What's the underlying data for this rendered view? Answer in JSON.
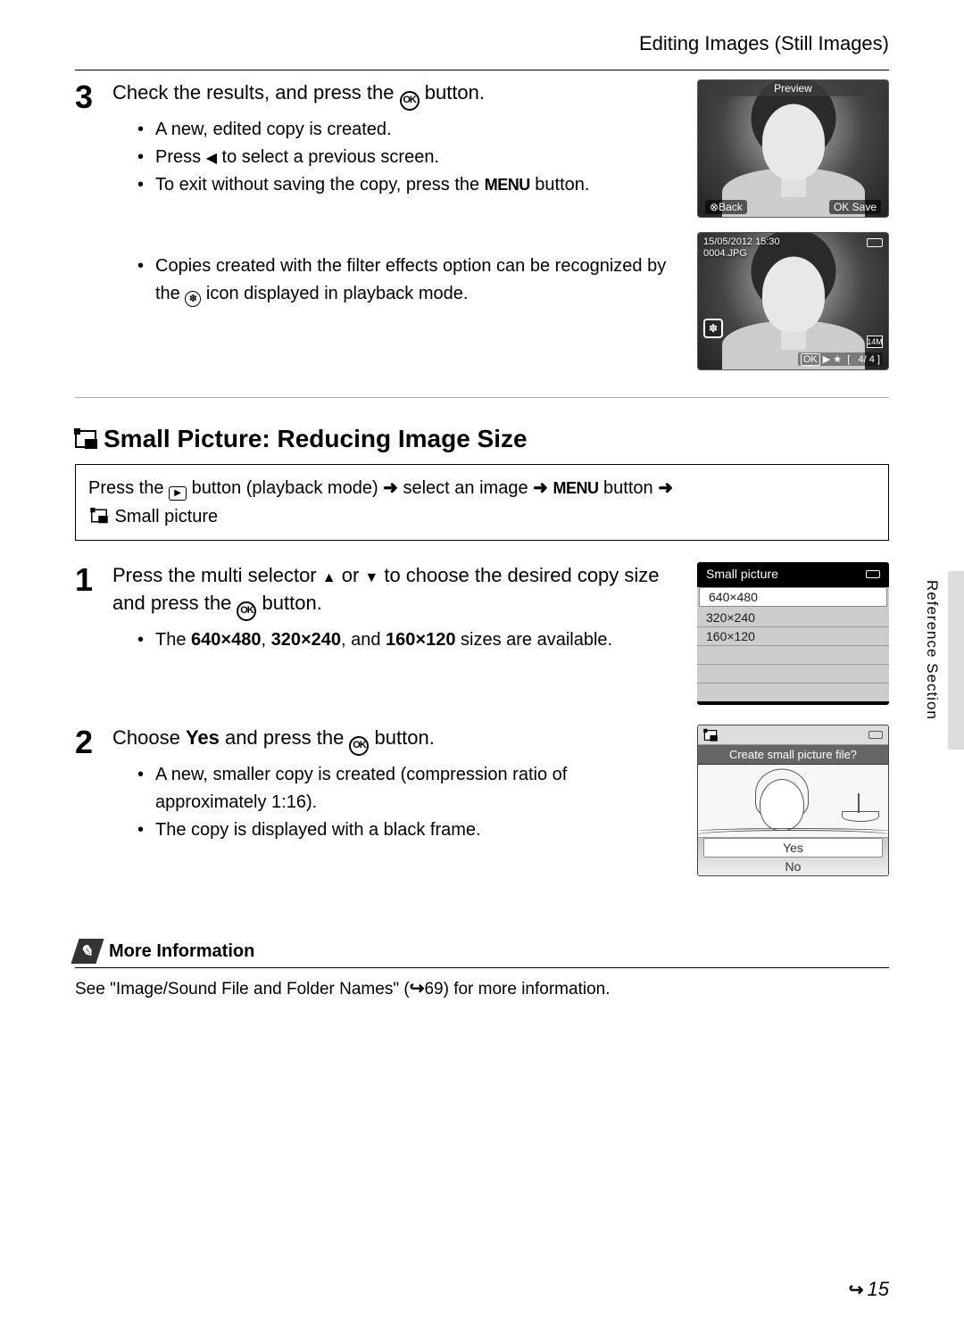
{
  "header": {
    "title": "Editing Images (Still Images)"
  },
  "step3": {
    "num": "3",
    "title_a": "Check the results, and press the ",
    "title_b": " button.",
    "bullets": [
      {
        "t1": "A new, edited copy is created."
      },
      {
        "t1": "Press ",
        "t2": " to select a previous screen."
      },
      {
        "t1": "To exit without saving the copy, press the ",
        "t2": " button."
      }
    ],
    "bullet2": {
      "t1": "Copies created with the filter effects option can be recognized by the ",
      "t2": " icon displayed in playback mode."
    }
  },
  "shot1": {
    "title": "Preview",
    "back": "Back",
    "save": "Save"
  },
  "shot2": {
    "date": "15/05/2012 15:30",
    "file": "0004.JPG",
    "index": "4/   4",
    "size": "14M"
  },
  "section": {
    "title": "Small Picture: Reducing Image Size",
    "path_a": "Press the ",
    "path_b": " button (playback mode) ",
    "path_c": " select an image ",
    "path_d": " button ",
    "path_e": " Small picture"
  },
  "step1": {
    "num": "1",
    "title_a": "Press the multi selector ",
    "title_b": " or ",
    "title_c": " to choose the desired copy size and press the ",
    "title_d": " button.",
    "bullet_a": "The ",
    "b640": "640×480",
    "sep1": ", ",
    "b320": "320×240",
    "sep2": ", and ",
    "b160": "160×120",
    "bullet_b": " sizes are available."
  },
  "uilist": {
    "title": "Small picture",
    "opts": [
      "640×480",
      "320×240",
      "160×120"
    ]
  },
  "step2": {
    "num": "2",
    "title_a": "Choose ",
    "yes": "Yes",
    "title_b": " and press the ",
    "title_c": " button.",
    "bullets": [
      "A new, smaller copy is created (compression ratio of approximately 1:16).",
      "The copy is displayed with a black frame."
    ]
  },
  "uiconfirm": {
    "prompt": "Create small picture file?",
    "yes": "Yes",
    "no": "No"
  },
  "more": {
    "head": "More Information",
    "text_a": "See \"Image/Sound File and Folder Names\" (",
    "text_b": "69) for more information."
  },
  "side": "Reference Section",
  "pagenum": "15"
}
